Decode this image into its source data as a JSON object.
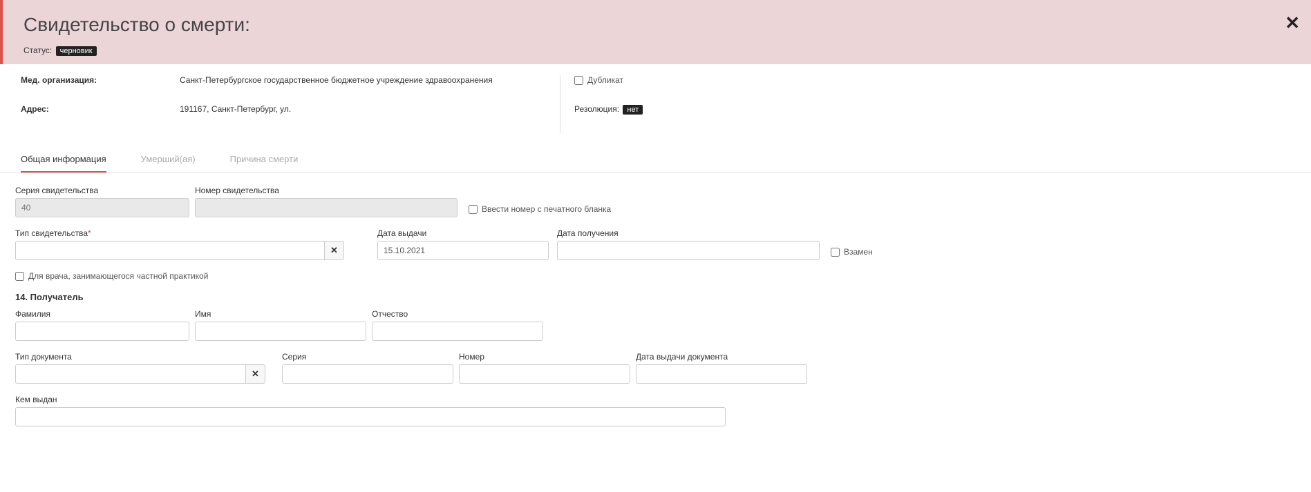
{
  "header": {
    "title": "Свидетельство о смерти:",
    "status_label": "Статус:",
    "status_value": "черновик"
  },
  "info": {
    "org_label": "Мед. организация:",
    "org_value": "Санкт-Петербургское государственное бюджетное учреждение здравоохранения",
    "addr_label": "Адрес:",
    "addr_value": "191167, Санкт-Петербург, ул.",
    "duplicate_label": "Дубликат",
    "resolution_label": "Резолюция:",
    "resolution_value": "нет"
  },
  "tabs": {
    "general": "Общая информация",
    "deceased": "Умерший(ая)",
    "cause": "Причина смерти"
  },
  "form": {
    "series_label": "Серия свидетельства",
    "series_value": "40",
    "number_label": "Номер свидетельства",
    "number_value": "",
    "enter_number_label": "Ввести номер с печатного бланка",
    "type_label": "Тип свидетельства",
    "type_value": "",
    "issue_date_label": "Дата выдачи",
    "issue_date_value": "15.10.2021",
    "receive_date_label": "Дата получения",
    "receive_date_value": "",
    "replace_label": "Взамен",
    "private_doc_label": "Для врача, занимающегося частной практикой",
    "recipient_header": "14. Получатель",
    "surname_label": "Фамилия",
    "name_label": "Имя",
    "patronymic_label": "Отчество",
    "doc_type_label": "Тип документа",
    "doc_series_label": "Серия",
    "doc_number_label": "Номер",
    "doc_issue_date_label": "Дата выдачи документа",
    "issued_by_label": "Кем выдан"
  }
}
